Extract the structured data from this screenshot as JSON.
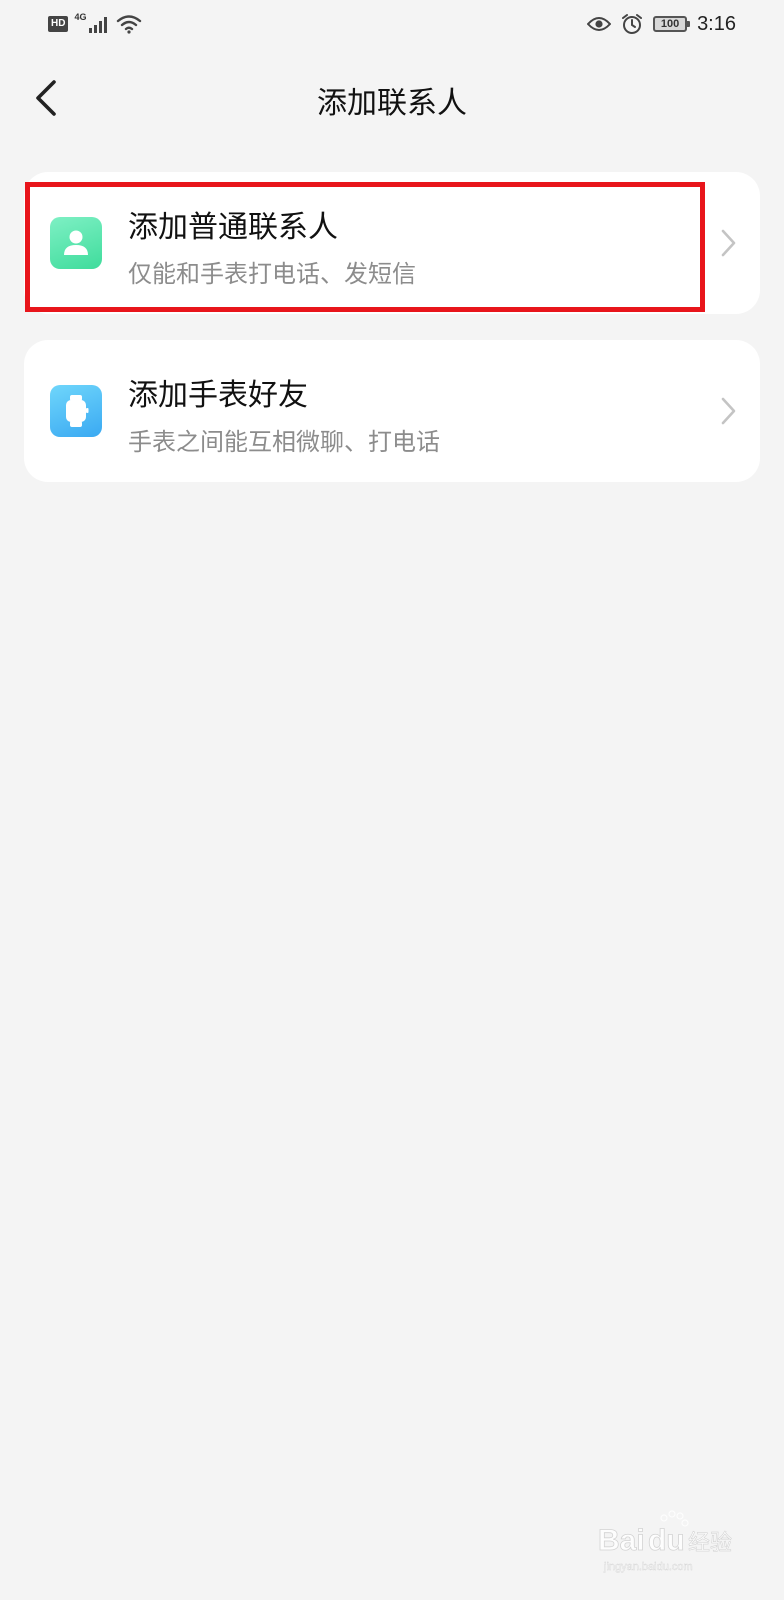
{
  "status_bar": {
    "hd": "HD",
    "network": "4G",
    "battery": "100",
    "time": "3:16"
  },
  "header": {
    "title": "添加联系人",
    "back_icon": "chevron-left-icon"
  },
  "options": [
    {
      "title": "添加普通联系人",
      "subtitle": "仅能和手表打电话、发短信",
      "icon": "person-icon",
      "icon_color": "#3fdc9c"
    },
    {
      "title": "添加手表好友",
      "subtitle": "手表之间能互相微聊、打电话",
      "icon": "watch-icon",
      "icon_color": "#3aa9f2"
    }
  ],
  "watermark": {
    "text": "Baidu经验",
    "subtext": "jingyan.baidu.com"
  },
  "colors": {
    "background": "#f4f4f4",
    "card": "#ffffff",
    "highlight": "#e8151b",
    "subtitle": "#8c8c8c"
  }
}
